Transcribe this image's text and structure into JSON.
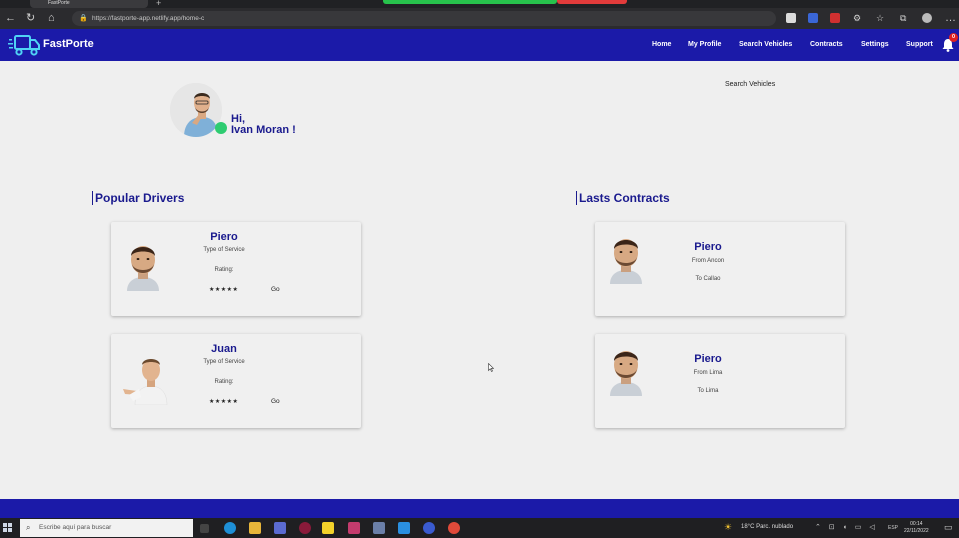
{
  "browser": {
    "tab_title": "FastPorte",
    "url": "https://fastporte-app.netlify.app/home-c",
    "new_tab_symbol": "+"
  },
  "navbar": {
    "brand": "FastPorte",
    "links": [
      "Home",
      "My Profile",
      "Search Vehicles",
      "Contracts",
      "Settings",
      "Support"
    ],
    "notification_count": "0"
  },
  "header": {
    "search_link": "Search Vehicles",
    "greeting_line1": "Hi,",
    "greeting_line2": "Ivan Moran !"
  },
  "popular_drivers": {
    "title": "Popular Drivers",
    "items": [
      {
        "name": "Piero",
        "service": "Type of Service",
        "rating_label": "Rating:",
        "stars": "★★★★★",
        "action": "Go"
      },
      {
        "name": "Juan",
        "service": "Type of Service",
        "rating_label": "Rating:",
        "stars": "★★★★★",
        "action": "Go"
      }
    ]
  },
  "last_contracts": {
    "title": "Lasts Contracts",
    "items": [
      {
        "name": "Piero",
        "from": "From Ancon",
        "to": "To Callao"
      },
      {
        "name": "Piero",
        "from": "From Lima",
        "to": "To Lima"
      }
    ]
  },
  "taskbar": {
    "search_placeholder": "Escribe aquí para buscar",
    "weather": "18°C  Parc. nublado",
    "language": "ESP",
    "time": "00:14",
    "date": "22/11/2022"
  },
  "colors": {
    "brand_blue": "#1b1aa8",
    "title_blue": "#1a1a8e",
    "online_green": "#2ecc71",
    "badge_red": "#e02020"
  }
}
